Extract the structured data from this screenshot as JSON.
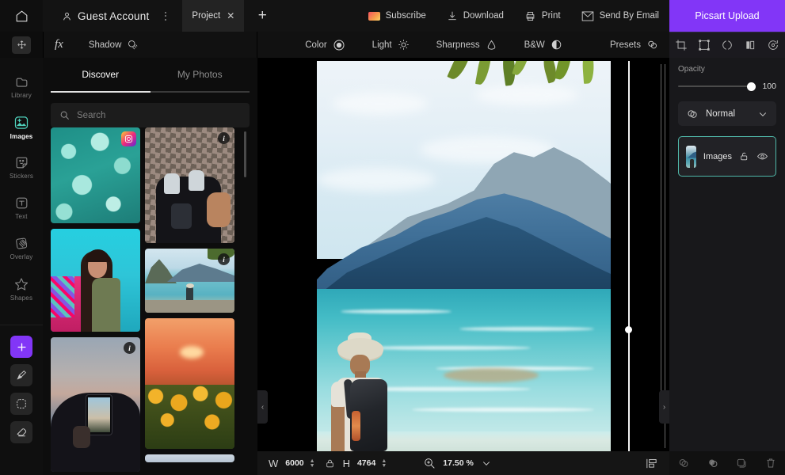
{
  "topbar": {
    "home_icon": "home-icon",
    "account_label": "Guest Account",
    "more_icon": "more-vertical-icon",
    "project_tab_label": "Project",
    "project_tab_close": "✕",
    "new_tab_label": "+",
    "actions": [
      {
        "label": "Subscribe",
        "icon": "subscribe-icon"
      },
      {
        "label": "Download",
        "icon": "download-icon"
      },
      {
        "label": "Print",
        "icon": "print-icon"
      },
      {
        "label": "Send By Email",
        "icon": "email-icon"
      }
    ],
    "upload_button_label": "Picsart Upload",
    "upload_button_color": "#8236f7"
  },
  "toolbar2": {
    "move_icon": "move-tool-icon",
    "fx_label": "fx",
    "shadow_label": "Shadow",
    "color_label": "Color",
    "light_label": "Light",
    "sharpness_label": "Sharpness",
    "bw_label": "B&W",
    "presets_label": "Presets",
    "right_icons": [
      "crop-icon",
      "transform-icon",
      "flip-icon",
      "mirror-icon",
      "rotate-icon"
    ]
  },
  "rail": {
    "items": [
      {
        "label": "Library",
        "icon": "library-icon",
        "active": false
      },
      {
        "label": "Images",
        "icon": "images-icon",
        "active": true
      },
      {
        "label": "Stickers",
        "icon": "stickers-icon",
        "active": false
      },
      {
        "label": "Text",
        "icon": "text-icon",
        "active": false
      },
      {
        "label": "Overlay",
        "icon": "overlay-icon",
        "active": false
      },
      {
        "label": "Shapes",
        "icon": "shapes-icon",
        "active": false
      }
    ],
    "tools": [
      {
        "icon": "add-icon",
        "accent": "#8236f7"
      },
      {
        "icon": "brush-icon",
        "accent": ""
      },
      {
        "icon": "shape-select-icon",
        "accent": ""
      },
      {
        "icon": "eraser-icon",
        "accent": ""
      }
    ]
  },
  "panel": {
    "tabs": [
      {
        "label": "Discover",
        "active": true
      },
      {
        "label": "My Photos",
        "active": false
      }
    ],
    "search": {
      "placeholder": "Search",
      "value": "",
      "icon": "search-icon"
    },
    "thumbs_left": [
      {
        "name": "pool-water-thumb",
        "badge": "instagram"
      },
      {
        "name": "woman-portrait-thumb",
        "badge": "none"
      },
      {
        "name": "phone-photographer-thumb",
        "badge": "info"
      }
    ],
    "thumbs_right": [
      {
        "name": "cobblestone-shoes-thumb",
        "badge": "info"
      },
      {
        "name": "lake-traveler-thumb",
        "badge": "info"
      },
      {
        "name": "sunflower-sunset-thumb",
        "badge": "none"
      },
      {
        "name": "partial-thumb",
        "badge": "none"
      }
    ]
  },
  "canvas": {
    "image_name": "mountain-beach-traveler-photo",
    "left_arrow": "‹",
    "right_arrow": "›",
    "guide_line": "vertical-guide"
  },
  "bottombar": {
    "width_label": "W",
    "width_value": "6000",
    "lock_icon": "lock-aspect-icon",
    "height_label": "H",
    "height_value": "4764",
    "zoom_icon": "zoom-in-icon",
    "zoom_value": "17.50 %",
    "zoom_caret": "⌄",
    "align_icon": "align-icon"
  },
  "rightpanel": {
    "opacity_label": "Opacity",
    "opacity_value": "100",
    "blend_mode": "Normal",
    "blend_icon": "blend-mode-icon",
    "blend_caret": "chevron-down-icon",
    "layer": {
      "name": "Images",
      "lock_icon": "unlock-icon",
      "visibility_icon": "eye-icon",
      "selected_color": "#4fb7a8"
    },
    "bottom_icons": [
      "merge-icon",
      "duplicate-icon",
      "copy-icon",
      "delete-icon"
    ]
  }
}
